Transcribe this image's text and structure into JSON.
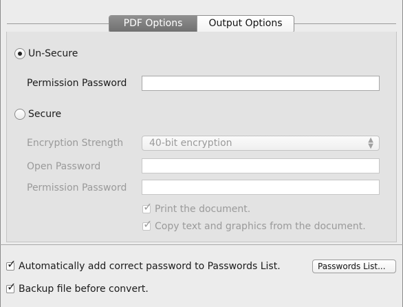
{
  "tabs": {
    "pdf_options": "PDF Options",
    "output_options": "Output Options"
  },
  "security": {
    "unsecure_label": "Un-Secure",
    "unsecure_selected": true,
    "permission_password_label": "Permission Password",
    "permission_password_value": "",
    "secure_label": "Secure",
    "secure_selected": false,
    "encryption_strength_label": "Encryption Strength",
    "encryption_strength_value": "40-bit encryption",
    "open_password_label": "Open Password",
    "open_password_value": "",
    "secure_permission_password_label": "Permission Password",
    "secure_permission_password_value": "",
    "print_label": "Print the document.",
    "print_checked": true,
    "copy_label": "Copy text and graphics from the document.",
    "copy_checked": true
  },
  "footer": {
    "auto_add_label": "Automatically add correct password to Passwords List.",
    "auto_add_checked": true,
    "passwords_list_button": "Passwords List...",
    "backup_label": "Backup file before convert.",
    "backup_checked": true
  }
}
